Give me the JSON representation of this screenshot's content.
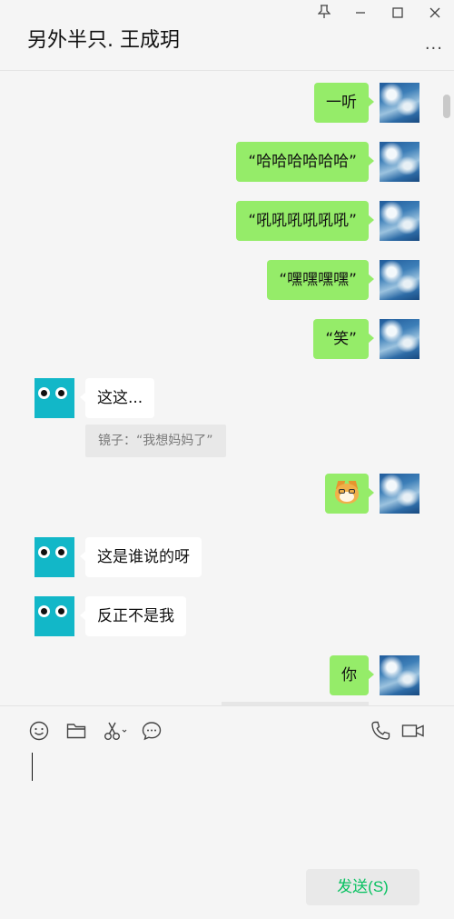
{
  "header": {
    "title": "另外半只. 王成玥",
    "pin_icon": "pin-icon",
    "minimize_icon": "minimize-icon",
    "maximize_icon": "maximize-icon",
    "close_icon": "close-icon",
    "more_icon": "more-icon",
    "more_glyph": "..."
  },
  "messages": [
    {
      "from": "me",
      "text": "一听"
    },
    {
      "from": "me",
      "text": "“哈哈哈哈哈哈”"
    },
    {
      "from": "me",
      "text": "“吼吼吼吼吼吼”"
    },
    {
      "from": "me",
      "text": "“嘿嘿嘿嘿”"
    },
    {
      "from": "me",
      "text": "“笑”"
    },
    {
      "from": "other",
      "text": "这这..."
    },
    {
      "from": "other",
      "quote": "镜子：“我想妈妈了”"
    },
    {
      "from": "me",
      "emoji": "doge-emoji"
    },
    {
      "from": "other",
      "text": "这是谁说的呀"
    },
    {
      "from": "other",
      "text": "反正不是我"
    },
    {
      "from": "me",
      "text": "你"
    }
  ],
  "toolbar": {
    "left_icons": [
      "emoji-icon",
      "folder-icon",
      "scissors-icon",
      "chat-bubble-icon"
    ],
    "right_icons": [
      "phone-icon",
      "video-call-icon"
    ]
  },
  "send_label": "发送(S)",
  "colors": {
    "me_bubble": "#95ec69",
    "other_bubble": "#ffffff",
    "background": "#f5f5f5",
    "send_text": "#07c160",
    "other_avatar": "#12b7c8"
  }
}
